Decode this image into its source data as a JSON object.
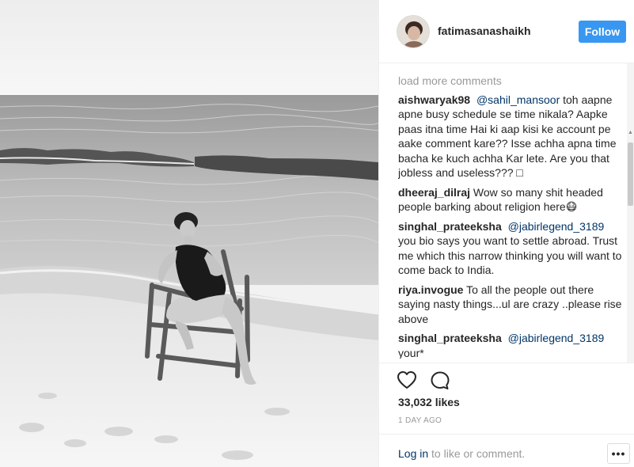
{
  "post": {
    "username": "fatimasanashaikh",
    "follow_label": "Follow"
  },
  "comments": {
    "load_more_label": "load more comments",
    "items": [
      {
        "author": "aishwaryak98",
        "mention": "@sahil_mansoor",
        "text": " toh aapne apne busy schedule se time nikala? Aapke paas itna time Hai ki aap kisi ke account pe aake comment kare?? Isse achha apna time bacha ke kuch achha Kar lete. Are you that jobless and useless??? □"
      },
      {
        "author": "dheeraj_dilraj",
        "mention": "",
        "text": " Wow so many shit headed people barking about religion here😷"
      },
      {
        "author": "singhal_prateeksha",
        "mention": "@jabirlegend_3189",
        "text": " you bio says you want to settle abroad. Trust me which this narrow thinking you will want to come back to India."
      },
      {
        "author": "riya.invogue",
        "mention": "",
        "text": " To all the people out there saying nasty things...ul are crazy ..please rise above"
      },
      {
        "author": "singhal_prateeksha",
        "mention": "@jabirlegend_3189",
        "text": " your*"
      }
    ]
  },
  "actions": {
    "like_icon": "heart-outline-icon",
    "comment_icon": "speech-bubble-icon",
    "likes": "33,032 likes",
    "timestamp": "1 DAY AGO"
  },
  "footer": {
    "login_link": "Log in",
    "login_rest": " to like or comment.",
    "more_label": "•••"
  },
  "colors": {
    "follow_button": "#3897f0",
    "link": "#003569",
    "muted": "#999999",
    "text": "#262626",
    "border": "#efefef"
  }
}
